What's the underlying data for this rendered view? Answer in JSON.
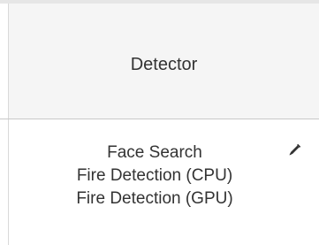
{
  "table": {
    "header": {
      "detector_label": "Detector"
    },
    "row": {
      "detectors": [
        "Face Search",
        "Fire Detection (CPU)",
        "Fire Detection (GPU)"
      ],
      "edit_icon": "pencil-icon"
    }
  },
  "colors": {
    "header_bg": "#f5f5f5",
    "text": "#333333",
    "border": "#c8c8c8"
  }
}
